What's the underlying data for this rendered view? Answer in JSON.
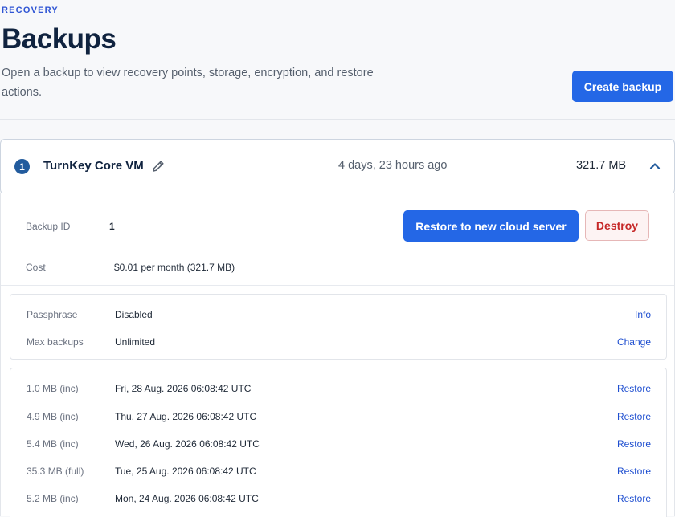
{
  "header": {
    "eyebrow": "RECOVERY",
    "title": "Backups",
    "subtitle": "Open a backup to view recovery points, storage, encryption, and restore actions.",
    "create_label": "Create backup"
  },
  "backup": {
    "number": "1",
    "name": "TurnKey Core VM",
    "age": "4 days, 23 hours ago",
    "size": "321.7 MB"
  },
  "detail": {
    "backup_id_label": "Backup ID",
    "backup_id_value": "1",
    "cost_label": "Cost",
    "cost_value": "$0.01 per month (321.7 MB)",
    "restore_new_label": "Restore to new cloud server",
    "destroy_label": "Destroy"
  },
  "settings": {
    "passphrase_label": "Passphrase",
    "passphrase_value": "Disabled",
    "passphrase_action": "Info",
    "max_label": "Max backups",
    "max_value": "Unlimited",
    "max_action": "Change"
  },
  "points": [
    {
      "size": "1.0 MB (inc)",
      "date": "Fri, 28 Aug. 2026 06:08:42 UTC",
      "action": "Restore"
    },
    {
      "size": "4.9 MB (inc)",
      "date": "Thu, 27 Aug. 2026 06:08:42 UTC",
      "action": "Restore"
    },
    {
      "size": "5.4 MB (inc)",
      "date": "Wed, 26 Aug. 2026 06:08:42 UTC",
      "action": "Restore"
    },
    {
      "size": "35.3 MB (full)",
      "date": "Tue, 25 Aug. 2026 06:08:42 UTC",
      "action": "Restore"
    },
    {
      "size": "5.2 MB (inc)",
      "date": "Mon, 24 Aug. 2026 06:08:42 UTC",
      "action": "Restore"
    }
  ],
  "icons": {
    "edit": "pencil-icon",
    "collapse": "chevron-up-icon"
  },
  "colors": {
    "accent": "#2467e6",
    "link": "#1f4fd0",
    "title": "#10233f",
    "danger": "#c62828",
    "badge": "#225b9d"
  }
}
